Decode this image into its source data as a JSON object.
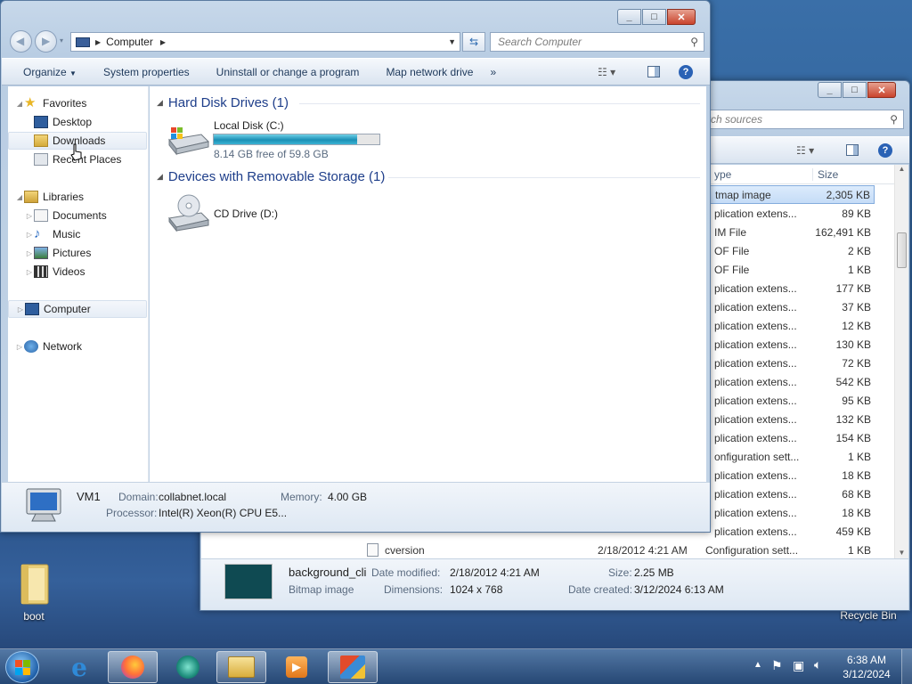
{
  "desktop": {
    "icons": [
      {
        "label": "boot"
      },
      {
        "label": "Recycle Bin"
      }
    ]
  },
  "main_window": {
    "address_crumb": "Computer",
    "search_placeholder": "Search Computer",
    "toolbar": {
      "organize": "Organize",
      "system_properties": "System properties",
      "uninstall": "Uninstall or change a program",
      "map_drive": "Map network drive",
      "more": "»"
    },
    "nav": {
      "favorites": "Favorites",
      "desktop": "Desktop",
      "downloads": "Downloads",
      "recent": "Recent Places",
      "libraries": "Libraries",
      "documents": "Documents",
      "music": "Music",
      "pictures": "Pictures",
      "videos": "Videos",
      "computer": "Computer",
      "network": "Network"
    },
    "groups": [
      {
        "title": "Hard Disk Drives (1)",
        "drive_name": "Local Disk (C:)",
        "free_text": "8.14 GB free of 59.8 GB",
        "used_fraction": 0.864
      },
      {
        "title": "Devices with Removable Storage (1)",
        "drive_name": "CD Drive (D:)"
      }
    ],
    "details": {
      "name": "VM1",
      "domain_label": "Domain:",
      "domain_value": "collabnet.local",
      "memory_label": "Memory:",
      "memory_value": "4.00 GB",
      "processor_label": "Processor:",
      "processor_value": "Intel(R) Xeon(R) CPU E5..."
    }
  },
  "second_window": {
    "search_placeholder": "rch sources",
    "columns": {
      "type": "ype",
      "size": "Size"
    },
    "rows": [
      {
        "type": "tmap image",
        "size": "2,305 KB"
      },
      {
        "type": "plication extens...",
        "size": "89 KB"
      },
      {
        "type": "IM File",
        "size": "162,491 KB"
      },
      {
        "type": "OF File",
        "size": "2 KB"
      },
      {
        "type": "OF File",
        "size": "1 KB"
      },
      {
        "type": "plication extens...",
        "size": "177 KB"
      },
      {
        "type": "plication extens...",
        "size": "37 KB"
      },
      {
        "type": "plication extens...",
        "size": "12 KB"
      },
      {
        "type": "plication extens...",
        "size": "130 KB"
      },
      {
        "type": "plication extens...",
        "size": "72 KB"
      },
      {
        "type": "plication extens...",
        "size": "542 KB"
      },
      {
        "type": "plication extens...",
        "size": "95 KB"
      },
      {
        "type": "plication extens...",
        "size": "132 KB"
      },
      {
        "type": "plication extens...",
        "size": "154 KB"
      },
      {
        "type": "onfiguration sett...",
        "size": "1 KB"
      },
      {
        "type": "plication extens...",
        "size": "18 KB"
      },
      {
        "type": "plication extens...",
        "size": "68 KB"
      },
      {
        "type": "plication extens...",
        "size": "18 KB"
      },
      {
        "type": "plication extens...",
        "size": "459 KB"
      }
    ],
    "full_rows": [
      {
        "name": "cversion",
        "date": "2/18/2012 4:21 AM",
        "type": "Configuration sett...",
        "size": "1 KB"
      }
    ],
    "details": {
      "name": "background_cli",
      "kind": "Bitmap image",
      "date_modified_label": "Date modified:",
      "date_modified": "2/18/2012 4:21 AM",
      "dimensions_label": "Dimensions:",
      "dimensions": "1024 x 768",
      "size_label": "Size:",
      "size": "2.25 MB",
      "date_created_label": "Date created:",
      "date_created": "3/12/2024 6:13 AM"
    }
  },
  "taskbar": {
    "time": "6:38 AM",
    "date": "3/12/2024"
  }
}
